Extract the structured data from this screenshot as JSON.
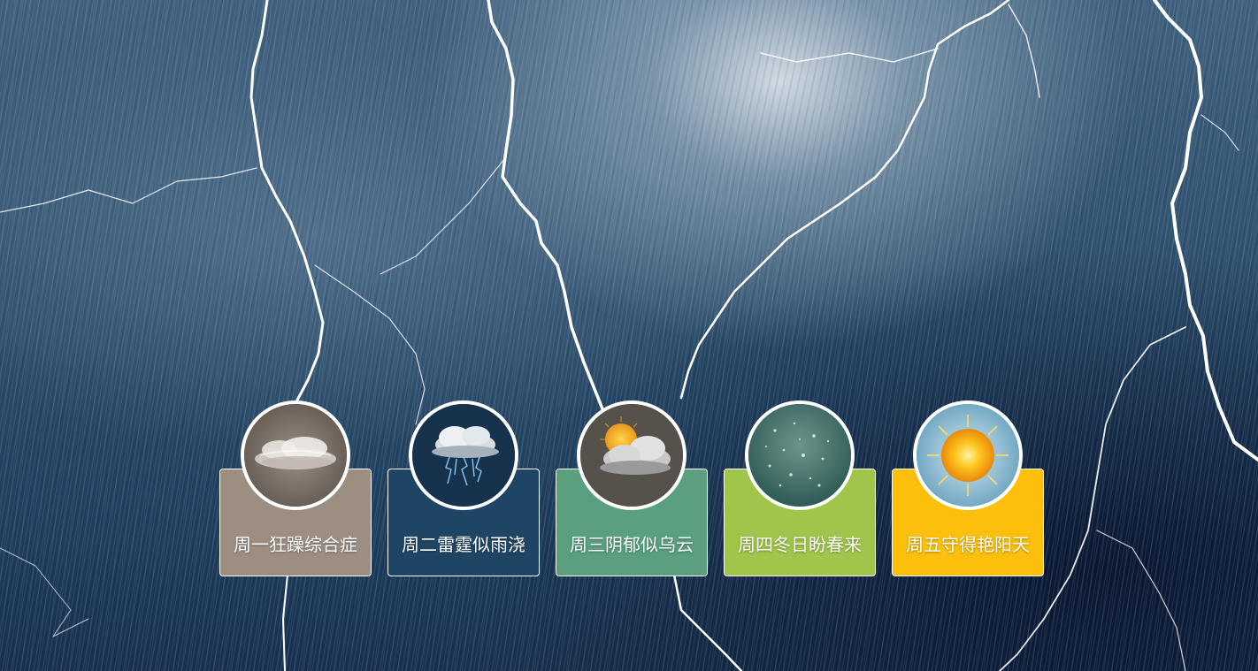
{
  "colors": {
    "card_mon": "#9c8f82",
    "card_tue": "#1f4566",
    "card_wed": "#5aa07e",
    "card_thu": "#9fc54a",
    "card_fri": "#fbbf0c"
  },
  "cards": [
    {
      "label": "周一狂躁综合症",
      "icon": "overcast-cloud-icon"
    },
    {
      "label": "周二雷霆似雨浇",
      "icon": "thunderstorm-icon"
    },
    {
      "label": "周三阴郁似乌云",
      "icon": "partly-cloudy-icon"
    },
    {
      "label": "周四冬日盼春来",
      "icon": "snow-icon"
    },
    {
      "label": "周五守得艳阳天",
      "icon": "sunny-icon"
    }
  ]
}
